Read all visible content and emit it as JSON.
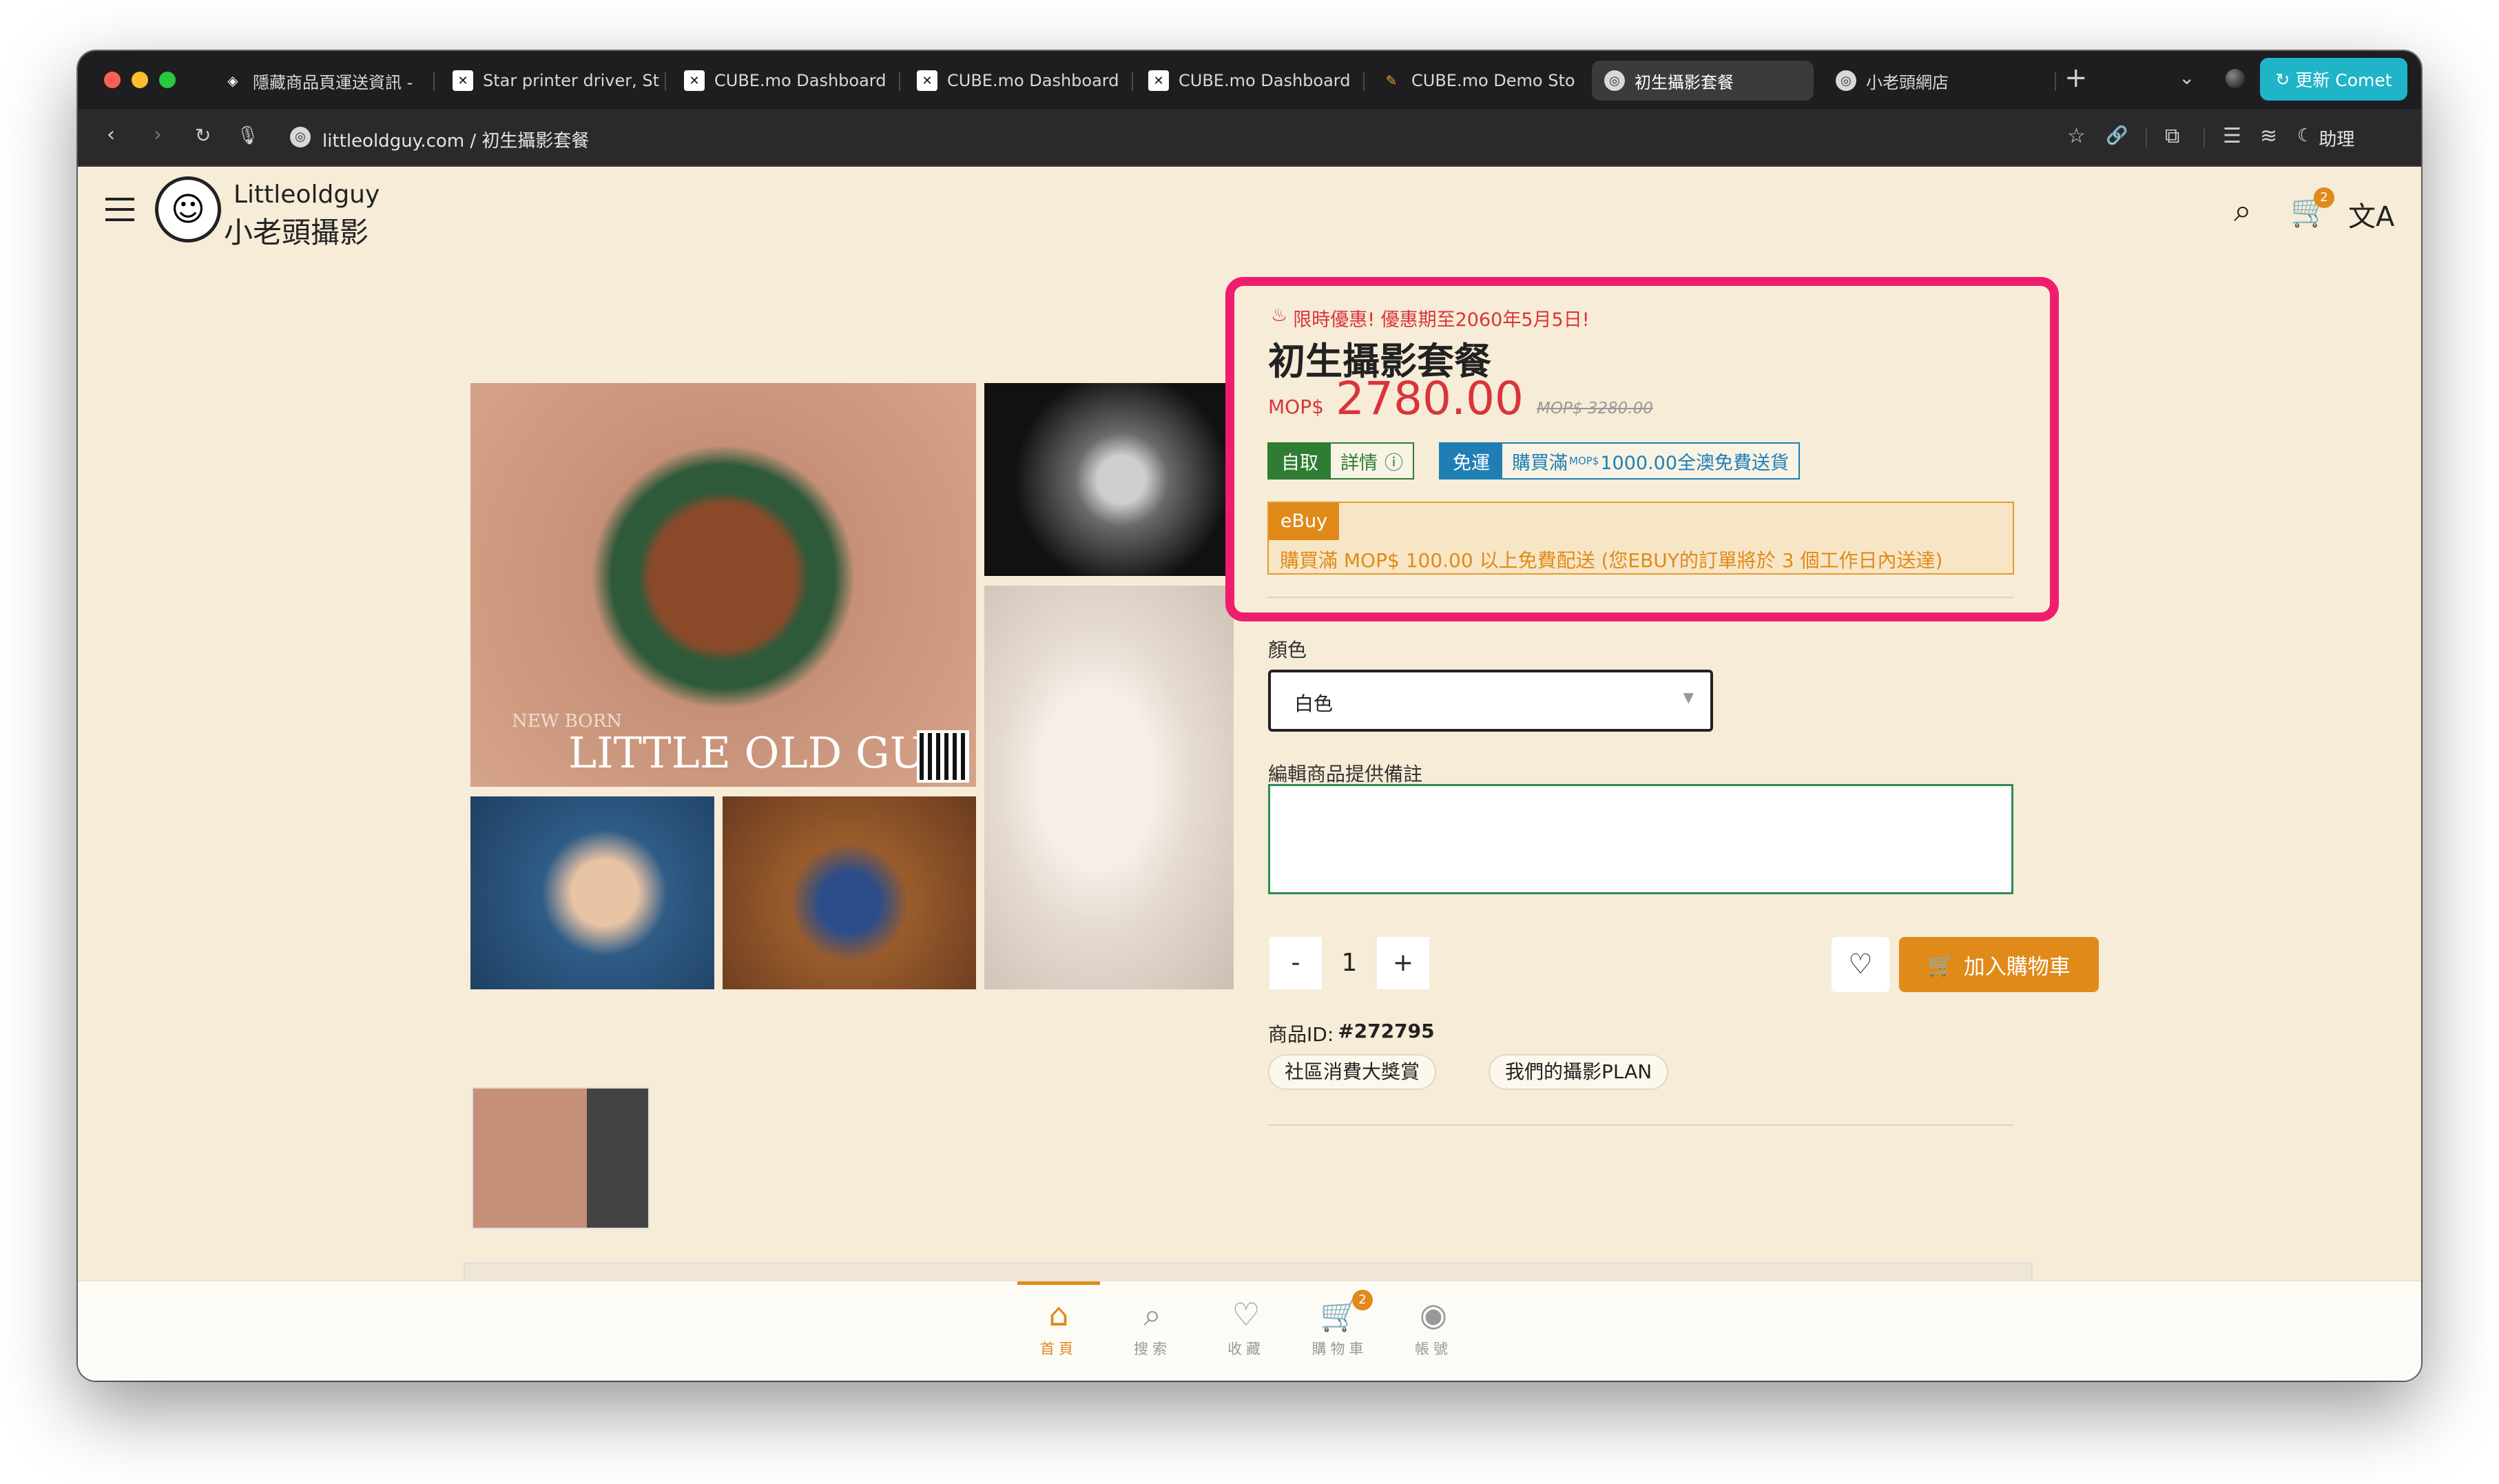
{
  "browser": {
    "tabs": [
      {
        "title": "隱藏商品頁運送資訊 -",
        "icon": "layers-icon"
      },
      {
        "title": "Star printer driver, St",
        "icon": "cube-logo-icon"
      },
      {
        "title": "CUBE.mo Dashboard",
        "icon": "cube-logo-icon"
      },
      {
        "title": "CUBE.mo Dashboard",
        "icon": "cube-logo-icon"
      },
      {
        "title": "CUBE.mo Dashboard",
        "icon": "cube-logo-icon"
      },
      {
        "title": "CUBE.mo Demo Store",
        "icon": "pen-icon"
      },
      {
        "title": "初生攝影套餐",
        "icon": "globe-icon",
        "active": true
      },
      {
        "title": "小老頭網店",
        "icon": "globe-icon"
      }
    ],
    "update_button": "更新 Comet",
    "url": "littleoldguy.com / 初生攝影套餐",
    "assistant_label": "助理",
    "new_tab": "+"
  },
  "header": {
    "brand_line1": "Littleoldguy",
    "brand_line2": "小老頭攝影",
    "cart_count": "2"
  },
  "product": {
    "promo_notice": "限時優惠! 優惠期至2060年5月5日!",
    "title": "初生攝影套餐",
    "currency": "MOP$",
    "price": "2780.00",
    "old_price": "MOP$ 3280.00",
    "pickup_tag": "自取",
    "pickup_detail": "詳情",
    "shipping_tag": "免運",
    "shipping_detail_prefix": "購買滿",
    "shipping_detail_currency": "MOP$",
    "shipping_detail_suffix": "1000.00全澳免費送貨",
    "ebuy_label": "eBuy",
    "ebuy_message": "購買滿 MOP$ 100.00 以上免費配送 (您EBUY的訂單將於 3 個工作日內送達)",
    "color_label": "顏色",
    "color_value": "白色",
    "note_label": "編輯商品提供備註",
    "note_value": "",
    "qty_minus": "-",
    "qty_value": "1",
    "qty_plus": "+",
    "add_to_cart": "加入購物車",
    "id_label": "商品ID:",
    "id_value": "#272795",
    "categories": [
      "社區消費大獎賞",
      "我們的攝影PLAN"
    ],
    "photo_caption_small": "NEW BORN",
    "photo_caption_big": "LITTLE OLD GUY"
  },
  "bottom_nav": [
    {
      "label": "首頁",
      "icon": "home-icon",
      "active": true
    },
    {
      "label": "搜索",
      "icon": "search-icon"
    },
    {
      "label": "收藏",
      "icon": "heart-icon"
    },
    {
      "label": "購物車",
      "icon": "cart-icon",
      "badge": "2"
    },
    {
      "label": "帳號",
      "icon": "account-icon"
    }
  ],
  "colors": {
    "accent": "#e08a1a",
    "price_red": "#d9343b",
    "highlight_border": "#ef1d6e",
    "page_bg": "#f6ecd7",
    "pickup_green": "#2e7d32",
    "shipping_blue": "#1f7fb5",
    "update_button": "#1fb4c8"
  }
}
